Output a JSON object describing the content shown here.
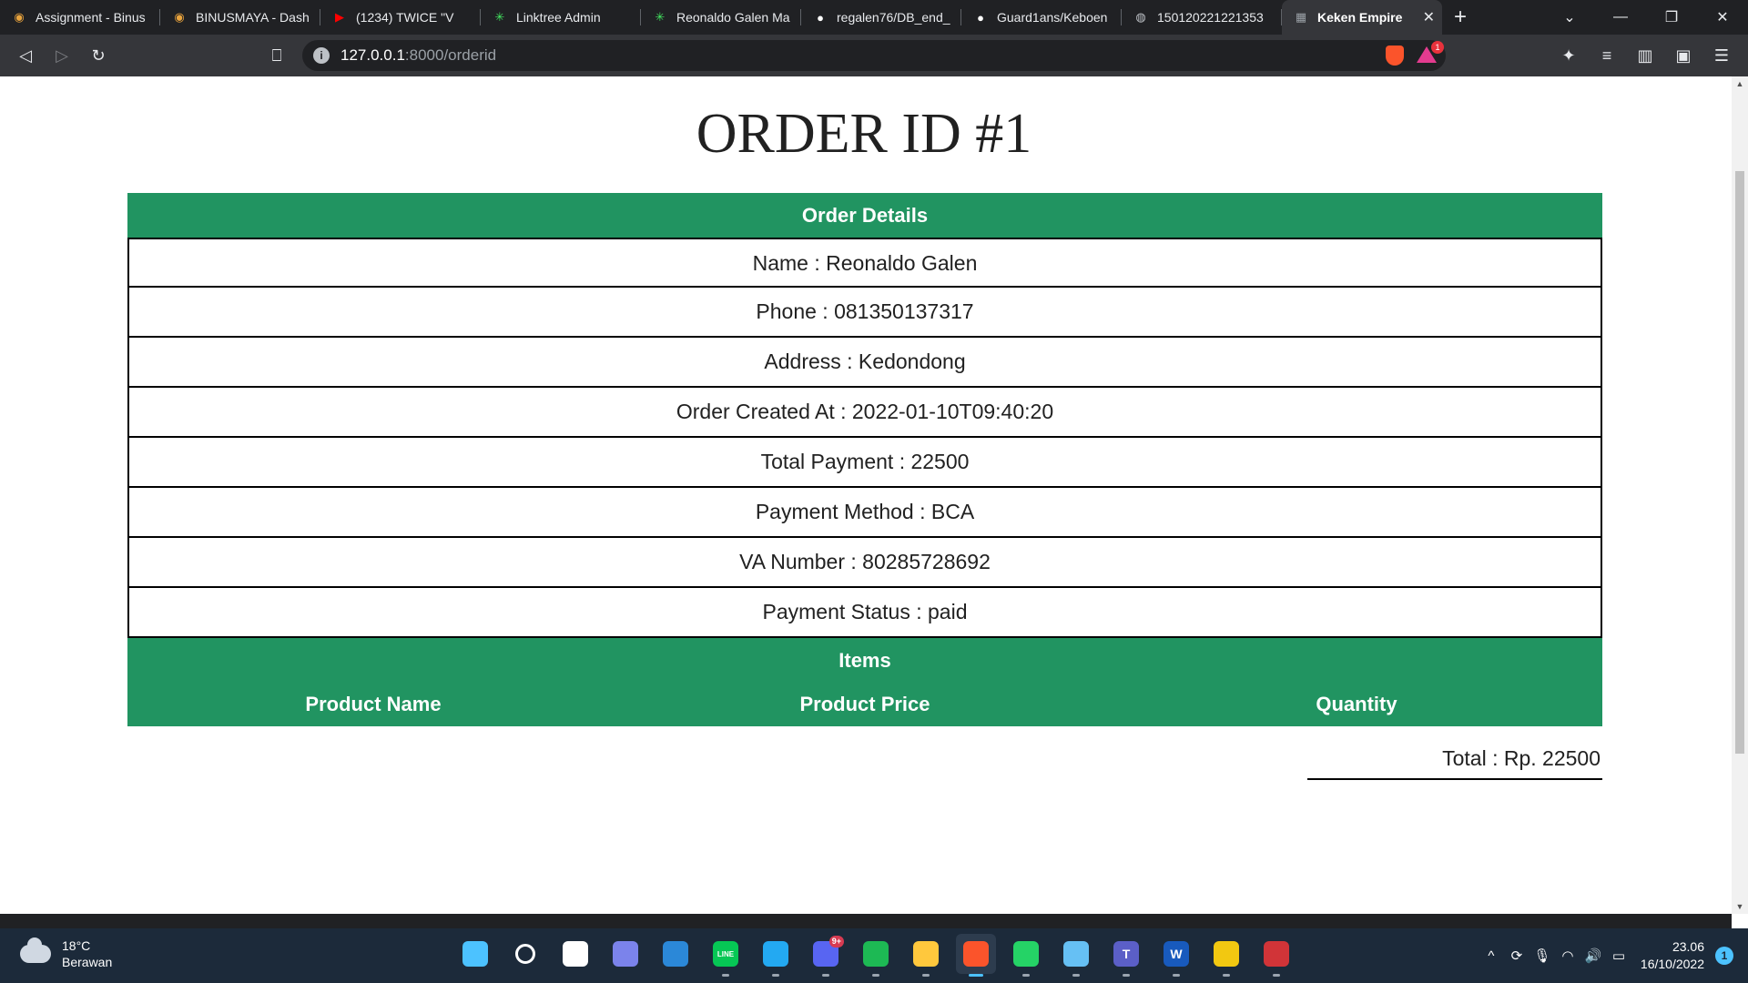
{
  "browser": {
    "tabs": [
      {
        "title": "Assignment - Binus",
        "icon": "binus-icon",
        "color": "#e8a33d"
      },
      {
        "title": "BINUSMAYA - Dash",
        "icon": "binus-icon",
        "color": "#e8a33d"
      },
      {
        "title": "(1234) TWICE \"V",
        "icon": "youtube-icon",
        "color": "#ff0000"
      },
      {
        "title": "Linktree Admin",
        "icon": "linktree-icon",
        "color": "#43e660"
      },
      {
        "title": "Reonaldo Galen Ma",
        "icon": "linktree-icon",
        "color": "#43e660"
      },
      {
        "title": "regalen76/DB_end_",
        "icon": "github-icon",
        "color": "#ffffff"
      },
      {
        "title": "Guard1ans/Keboen",
        "icon": "github-icon",
        "color": "#ffffff"
      },
      {
        "title": "150120221221353",
        "icon": "globe-icon",
        "color": "#bdc1c6"
      },
      {
        "title": "Keken Empire",
        "icon": "page-icon",
        "color": "#9aa0a6",
        "active": true
      }
    ],
    "url_host": "127.0.0.1",
    "url_path": ":8000/orderid",
    "shield_color": "#fb542b",
    "rewards_badge": "1"
  },
  "page": {
    "title": "ORDER ID #1",
    "details_header": "Order Details",
    "details": [
      "Name : Reonaldo Galen",
      "Phone : 081350137317",
      "Address : Kedondong",
      "Order Created At : 2022-01-10T09:40:20",
      "Total Payment : 22500",
      "Payment Method : BCA",
      "VA Number : 80285728692",
      "Payment Status : paid"
    ],
    "items_header": "Items",
    "item_columns": [
      "Product Name",
      "Product Price",
      "Quantity"
    ],
    "total": "Total : Rp. 22500",
    "accent_color": "#219461"
  },
  "taskbar": {
    "weather_temp": "18°C",
    "weather_desc": "Berawan",
    "apps": [
      {
        "name": "windows-start-icon",
        "label": "",
        "color": "#4cc2ff"
      },
      {
        "name": "search-icon",
        "label": "",
        "color": "#ffffff"
      },
      {
        "name": "task-view-icon",
        "label": "",
        "color": "#ffffff"
      },
      {
        "name": "teams-chat-icon",
        "label": "",
        "color": "#7b83eb"
      },
      {
        "name": "mail-icon",
        "label": "",
        "color": "#2b88d8"
      },
      {
        "name": "line-icon",
        "label": "LINE",
        "color": "#06c755"
      },
      {
        "name": "vscode-icon",
        "label": "",
        "color": "#23a9f2"
      },
      {
        "name": "discord-icon",
        "label": "",
        "color": "#5865f2",
        "badge": "9+"
      },
      {
        "name": "spotify-icon",
        "label": "",
        "color": "#1db954"
      },
      {
        "name": "file-explorer-icon",
        "label": "",
        "color": "#ffc83d"
      },
      {
        "name": "brave-icon",
        "label": "",
        "color": "#fb542b",
        "active": true
      },
      {
        "name": "whatsapp-icon",
        "label": "",
        "color": "#25d366"
      },
      {
        "name": "steam-icon",
        "label": "",
        "color": "#66c0f4"
      },
      {
        "name": "teams-icon",
        "label": "T",
        "color": "#5b5fc7"
      },
      {
        "name": "word-icon",
        "label": "W",
        "color": "#185abd"
      },
      {
        "name": "snipping-tool-icon",
        "label": "",
        "color": "#f2c811"
      },
      {
        "name": "red-app-icon",
        "label": "",
        "color": "#d13438"
      }
    ],
    "time": "23.06",
    "date": "16/10/2022",
    "notifications": "1"
  }
}
